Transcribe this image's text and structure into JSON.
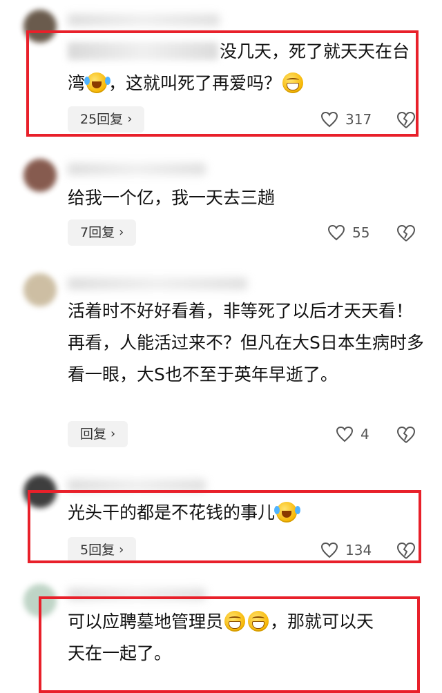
{
  "comments": [
    {
      "text": "没几天，死了就天天在台\n湾",
      "text_after_emoji": "，这就叫死了再爱吗？",
      "reply": "25回复",
      "likes": "317",
      "emoji_1": "cry-laugh-icon",
      "emoji_2": "grin-icon",
      "highlighted": true
    },
    {
      "text": "给我一个亿，我一天去三趟",
      "reply": "7回复",
      "likes": "55",
      "highlighted": false
    },
    {
      "text": "活着时不好好看着，非等死了以后才天天看！再看，人能活过来不？但凡在大S日本生病时多看一眼，大S也不至于英年早逝了。",
      "reply": "回复",
      "likes": "4",
      "highlighted": false
    },
    {
      "text": "光头干的都是不花钱的事儿",
      "reply": "5回复",
      "likes": "134",
      "emoji_1": "cry-laugh-icon",
      "highlighted": true
    },
    {
      "text": "可以应聘墓地管理员",
      "text_after_emoji": "，那就可以天\n天在一起了。",
      "emoji_1": "grin-icon",
      "emoji_2": "grin-icon",
      "highlighted": true
    }
  ],
  "icons": {
    "like": "heart-outline-icon",
    "dislike": "broken-heart-icon",
    "reply_arrow": "chevron-right-icon"
  },
  "colors": {
    "highlight_box": "#e8202a",
    "reply_bg": "#f2f2f2"
  },
  "chevron": "›"
}
